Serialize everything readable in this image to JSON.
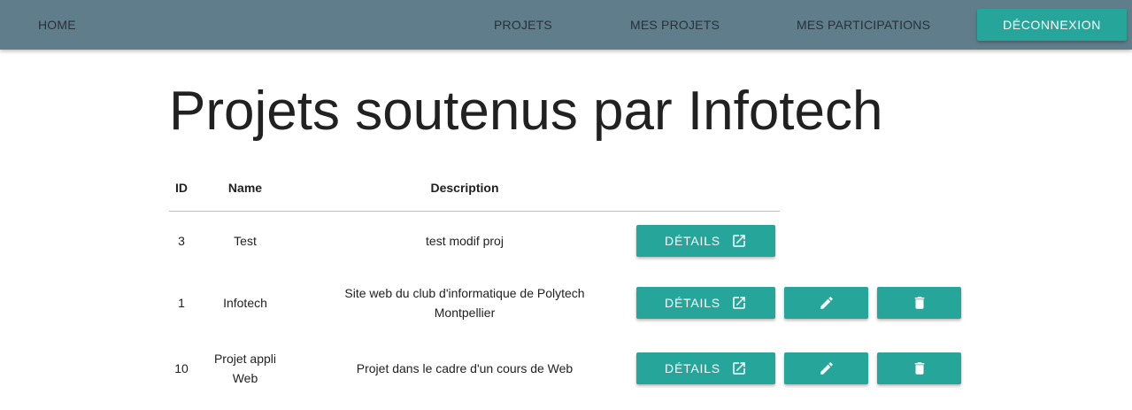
{
  "nav": {
    "home": "HOME",
    "projets": "PROJETS",
    "mes_projets": "MES PROJETS",
    "mes_participations": "MES PARTICIPATIONS",
    "logout": "DÉCONNEXION"
  },
  "page": {
    "title": "Projets soutenus par Infotech"
  },
  "table": {
    "headers": {
      "id": "ID",
      "name": "Name",
      "description": "Description"
    },
    "details_label": "DÉTAILS",
    "rows": [
      {
        "id": "3",
        "name": "Test",
        "description": "test modif proj",
        "editable": false
      },
      {
        "id": "1",
        "name": "Infotech",
        "description_line1": "Site web du club d'informatique de Polytech",
        "description_line2": "Montpellier",
        "editable": true
      },
      {
        "id": "10",
        "name_line1": "Projet appli",
        "name_line2": "Web",
        "description": "Projet dans le cadre d'un cours de Web",
        "editable": true
      }
    ]
  },
  "icons": {
    "details": "open-in-new-icon",
    "edit": "pencil-icon",
    "delete": "trash-icon"
  },
  "colors": {
    "navbar": "#607d8b",
    "accent": "#26a69a",
    "text": "#212121"
  }
}
